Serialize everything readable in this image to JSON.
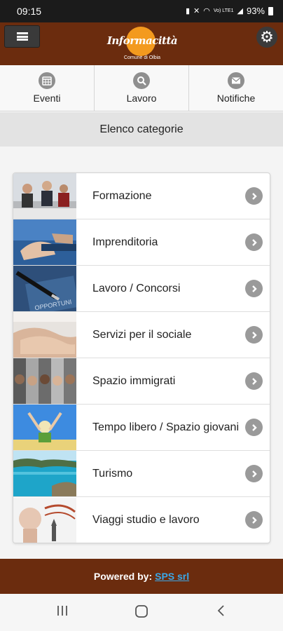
{
  "status": {
    "time": "09:15",
    "network": "Vo) LTE1",
    "battery": "93%"
  },
  "app": {
    "logo_text": "Informacittà",
    "logo_subtitle": "Comune di Olbia"
  },
  "nav": [
    {
      "label": "Eventi",
      "icon": "calendar-icon"
    },
    {
      "label": "Lavoro",
      "icon": "search-icon"
    },
    {
      "label": "Notifiche",
      "icon": "envelope-icon"
    }
  ],
  "section": {
    "title": "Elenco categorie"
  },
  "categories": [
    {
      "label": "Formazione"
    },
    {
      "label": "Imprenditoria"
    },
    {
      "label": "Lavoro / Concorsi"
    },
    {
      "label": "Servizi per il sociale"
    },
    {
      "label": "Spazio immigrati"
    },
    {
      "label": "Tempo libero / Spazio giovani"
    },
    {
      "label": "Turismo"
    },
    {
      "label": "Viaggi studio e lavoro"
    }
  ],
  "footer": {
    "prefix": "Powered by:",
    "link_text": "SPS srl"
  },
  "colors": {
    "brand": "#6b2c0e",
    "accent": "#f39a1e",
    "link": "#3aa8e8"
  }
}
